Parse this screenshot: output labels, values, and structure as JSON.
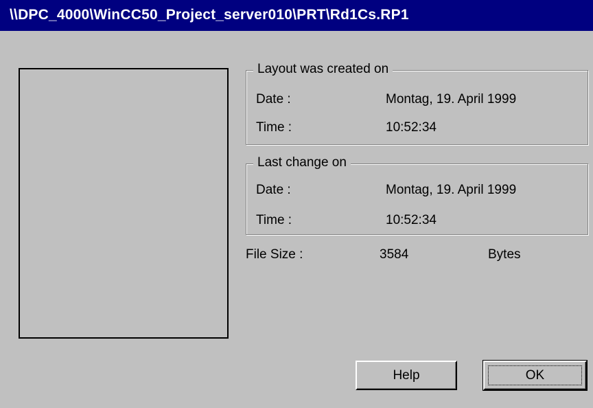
{
  "window": {
    "title": "\\\\DPC_4000\\WinCC50_Project_server010\\PRT\\Rd1Cs.RP1"
  },
  "created": {
    "legend": "Layout was created on",
    "date_label": "Date :",
    "date_value": "Montag, 19. April 1999",
    "time_label": "Time :",
    "time_value": "10:52:34"
  },
  "changed": {
    "legend": "Last change on",
    "date_label": "Date :",
    "date_value": "Montag, 19. April 1999",
    "time_label": "Time :",
    "time_value": "10:52:34"
  },
  "file": {
    "label": "File Size :",
    "value": "3584",
    "unit": "Bytes"
  },
  "buttons": {
    "help": "Help",
    "ok": "OK"
  },
  "colors": {
    "titlebar": "#000080",
    "face": "#c0c0c0"
  }
}
